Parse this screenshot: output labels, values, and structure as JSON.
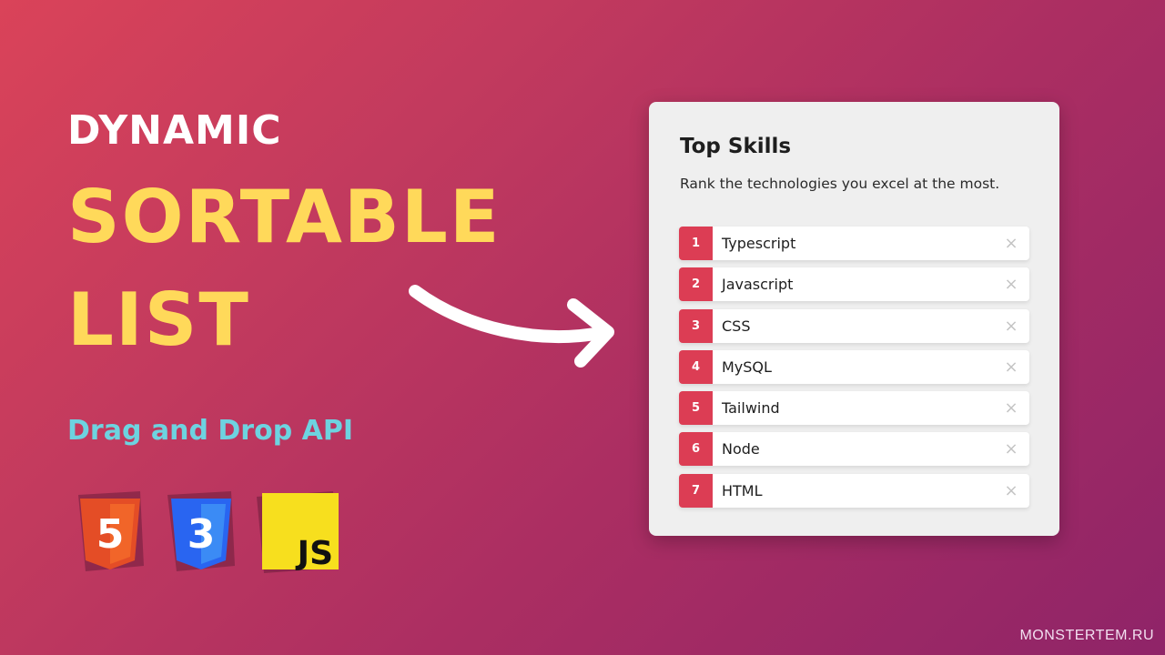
{
  "hero": {
    "line1": "DYNAMIC",
    "line2": "SORTABLE",
    "line3": "LIST",
    "subtitle": "Drag and Drop API"
  },
  "logos": [
    {
      "name": "html5-logo",
      "glyph": "5",
      "color": "#e44d26"
    },
    {
      "name": "css3-logo",
      "glyph": "3",
      "color": "#2965f1"
    },
    {
      "name": "js-logo",
      "glyph": "JS",
      "color": "#f7df1e"
    }
  ],
  "card": {
    "title": "Top Skills",
    "subtitle": "Rank the technologies you excel at the most.",
    "remove_icon": "×",
    "accent_color": "#dc3d54",
    "items": [
      {
        "rank": "1",
        "name": "Typescript"
      },
      {
        "rank": "2",
        "name": "Javascript"
      },
      {
        "rank": "3",
        "name": "CSS"
      },
      {
        "rank": "4",
        "name": "MySQL"
      },
      {
        "rank": "5",
        "name": "Tailwind"
      },
      {
        "rank": "6",
        "name": "Node"
      },
      {
        "rank": "7",
        "name": "HTML"
      }
    ]
  },
  "watermark": "MONSTERTEM.RU",
  "colors": {
    "bg_start": "#da4359",
    "bg_end": "#8f2468",
    "headline_white": "#ffffff",
    "headline_yellow": "#ffd95a",
    "subtitle_cyan": "#6dd3e0"
  }
}
